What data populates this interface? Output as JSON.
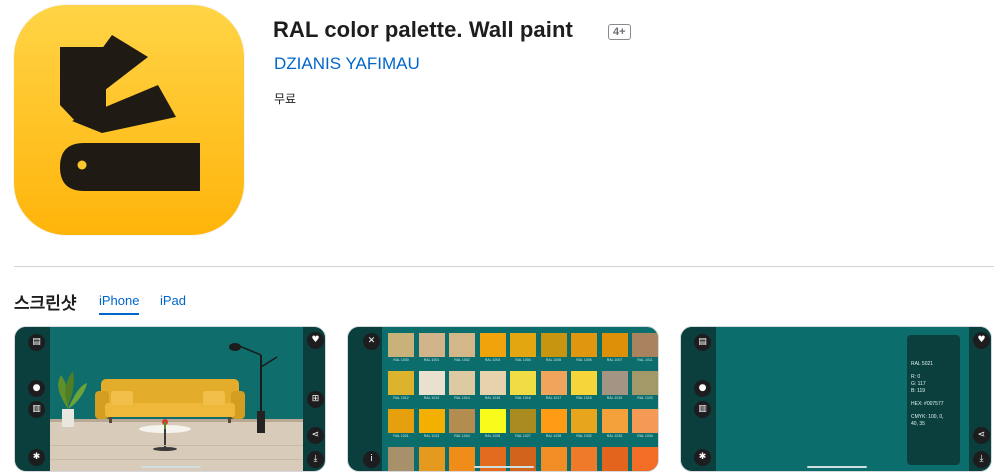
{
  "app": {
    "title": "RAL color palette. Wall paint",
    "age_rating": "4+",
    "developer": "DZIANIS YAFIMAU",
    "price": "무료",
    "icon": "color-fan-deck-icon",
    "icon_colors": {
      "top": "#ffd446",
      "bottom": "#ffb40a",
      "glyph": "#1f1a14"
    }
  },
  "screenshots": {
    "title": "스크린샷",
    "tabs": [
      {
        "label": "iPhone",
        "selected": true
      },
      {
        "label": "iPad",
        "selected": false
      }
    ]
  },
  "shot2": {
    "swatch_labels": [
      [
        "RAL 1000",
        "RAL 1001",
        "RAL 1002",
        "RAL 1003",
        "RAL 1004",
        "RAL 1005",
        "RAL 1006",
        "RAL 1007",
        "RAL 1011"
      ],
      [
        "RAL 1012",
        "RAL 1013",
        "RAL 1014",
        "RAL 1015",
        "RAL 1016",
        "RAL 1017",
        "RAL 1018",
        "RAL 1019",
        "RAL 1020"
      ],
      [
        "RAL 1021",
        "RAL 1023",
        "RAL 1024",
        "RAL 1026",
        "RAL 1027",
        "RAL 1028",
        "RAL 1032",
        "RAL 1033",
        "RAL 1034"
      ]
    ],
    "swatch_colors": [
      [
        "#c8b27a",
        "#d1b489",
        "#d3b789",
        "#f0a30b",
        "#e3a611",
        "#c89510",
        "#e0970f",
        "#de9009",
        "#a9835f"
      ],
      [
        "#ddb22c",
        "#e9e1cd",
        "#ddc9a2",
        "#e6d3ae",
        "#f0dd45",
        "#f0a45c",
        "#f6d53b",
        "#a49483",
        "#a29868"
      ],
      [
        "#e6a00e",
        "#f4b000",
        "#b38c4f",
        "#f9fb1a",
        "#a98b20",
        "#ff9b14",
        "#e7a51e",
        "#f4a13b",
        "#f59a54"
      ],
      [
        "#a8906a",
        "#e39a1e",
        "#f08c1a",
        "#e36b1d",
        "#d2631c",
        "#f08d24",
        "#ef7a2a",
        "#e3641c",
        "#f46d25"
      ]
    ]
  },
  "shot3": {
    "color_name": "RAL 5021",
    "rgb_r": "R: 0",
    "rgb_g": "G: 117",
    "rgb_b": "B: 119",
    "hex": "HEX: #007577",
    "cmyk_line1": "CMYK: 100, 0,",
    "cmyk_line2": "40, 35"
  }
}
